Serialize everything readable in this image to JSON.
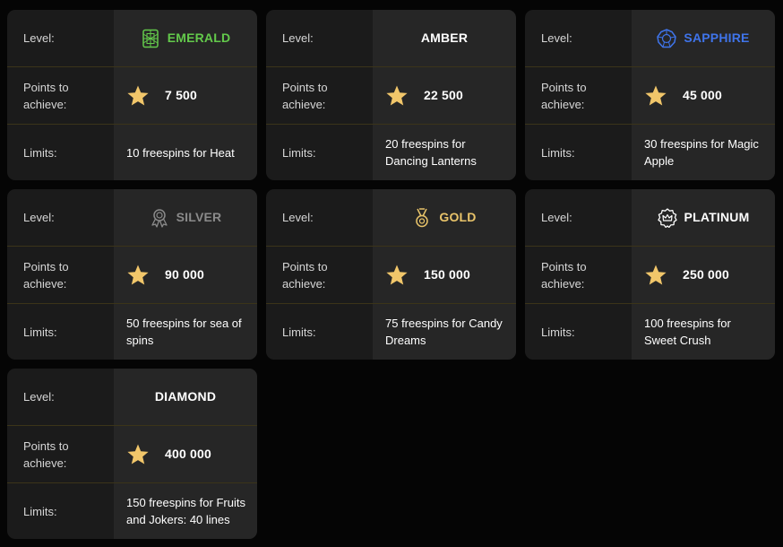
{
  "labels": {
    "level": "Level:",
    "points": "Points to achieve:",
    "limits": "Limits:"
  },
  "levels": [
    {
      "name": "EMERALD",
      "icon": "emerald-gem-icon",
      "color": "#63c94b",
      "points": "7 500",
      "limits": "10 freespins for Heat"
    },
    {
      "name": "AMBER",
      "icon": "",
      "color": "#ffffff",
      "points": "22 500",
      "limits": "20 freespins for Dancing Lanterns"
    },
    {
      "name": "SAPPHIRE",
      "icon": "sapphire-gem-icon",
      "color": "#3f74ea",
      "points": "45 000",
      "limits": "30 freespins for Magic Apple"
    },
    {
      "name": "SILVER",
      "icon": "ribbon-medal-icon",
      "color": "#8a8a8a",
      "points": "90 000",
      "limits": "50 freespins for sea of spins"
    },
    {
      "name": "GOLD",
      "icon": "gold-medal-icon",
      "color": "#e9c46a",
      "points": "150 000",
      "limits": "75 freespins for Candy Dreams"
    },
    {
      "name": "PLATINUM",
      "icon": "crown-badge-icon",
      "color": "#ffffff",
      "points": "250 000",
      "limits": "100 freespins for Sweet Crush"
    },
    {
      "name": "DIAMOND",
      "icon": "",
      "color": "#ffffff",
      "points": "400 000",
      "limits": "150 freespins for Fruits and Jokers: 40 lines"
    }
  ],
  "star_color": "#f1c66a"
}
